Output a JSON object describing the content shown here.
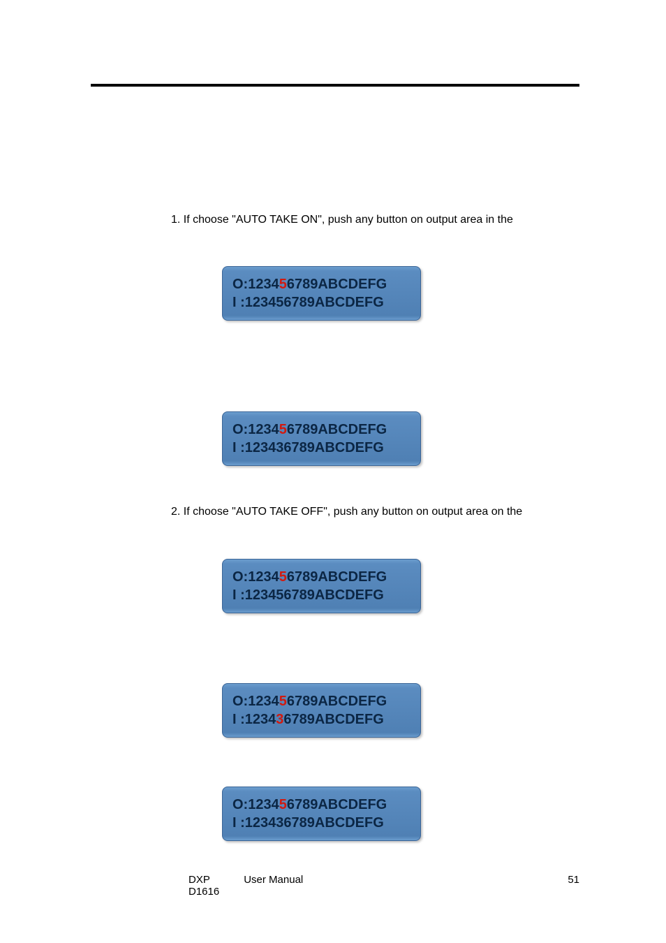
{
  "paragraphs": {
    "p1": "1. If choose \"AUTO TAKE ON\", push any button on output area in the",
    "p2": "2. If choose \"AUTO TAKE OFF\", push any button on output area on the"
  },
  "lcd_screens": [
    {
      "o_pre": "O:1234",
      "o_hl": "5",
      "o_post": "6789ABCDEFG",
      "i_pre": "I :123456789ABCDEFG",
      "i_hl": "",
      "i_post": ""
    },
    {
      "o_pre": "O:1234",
      "o_hl": "5",
      "o_post": "6789ABCDEFG",
      "i_pre": "I :123436789ABCDEFG",
      "i_hl": "",
      "i_post": ""
    },
    {
      "o_pre": "O:1234",
      "o_hl": "5",
      "o_post": "6789ABCDEFG",
      "i_pre": "I :123456789ABCDEFG",
      "i_hl": "",
      "i_post": ""
    },
    {
      "o_pre": "O:1234",
      "o_hl": "5",
      "o_post": "6789ABCDEFG",
      "i_pre": "I :1234",
      "i_hl": "3",
      "i_post": "6789ABCDEFG"
    },
    {
      "o_pre": "O:1234",
      "o_hl": "5",
      "o_post": "6789ABCDEFG",
      "i_pre": "I :123436789ABCDEFG",
      "i_hl": "",
      "i_post": ""
    }
  ],
  "footer": {
    "left": "DXP D1616",
    "center": "User Manual",
    "right": "51"
  }
}
